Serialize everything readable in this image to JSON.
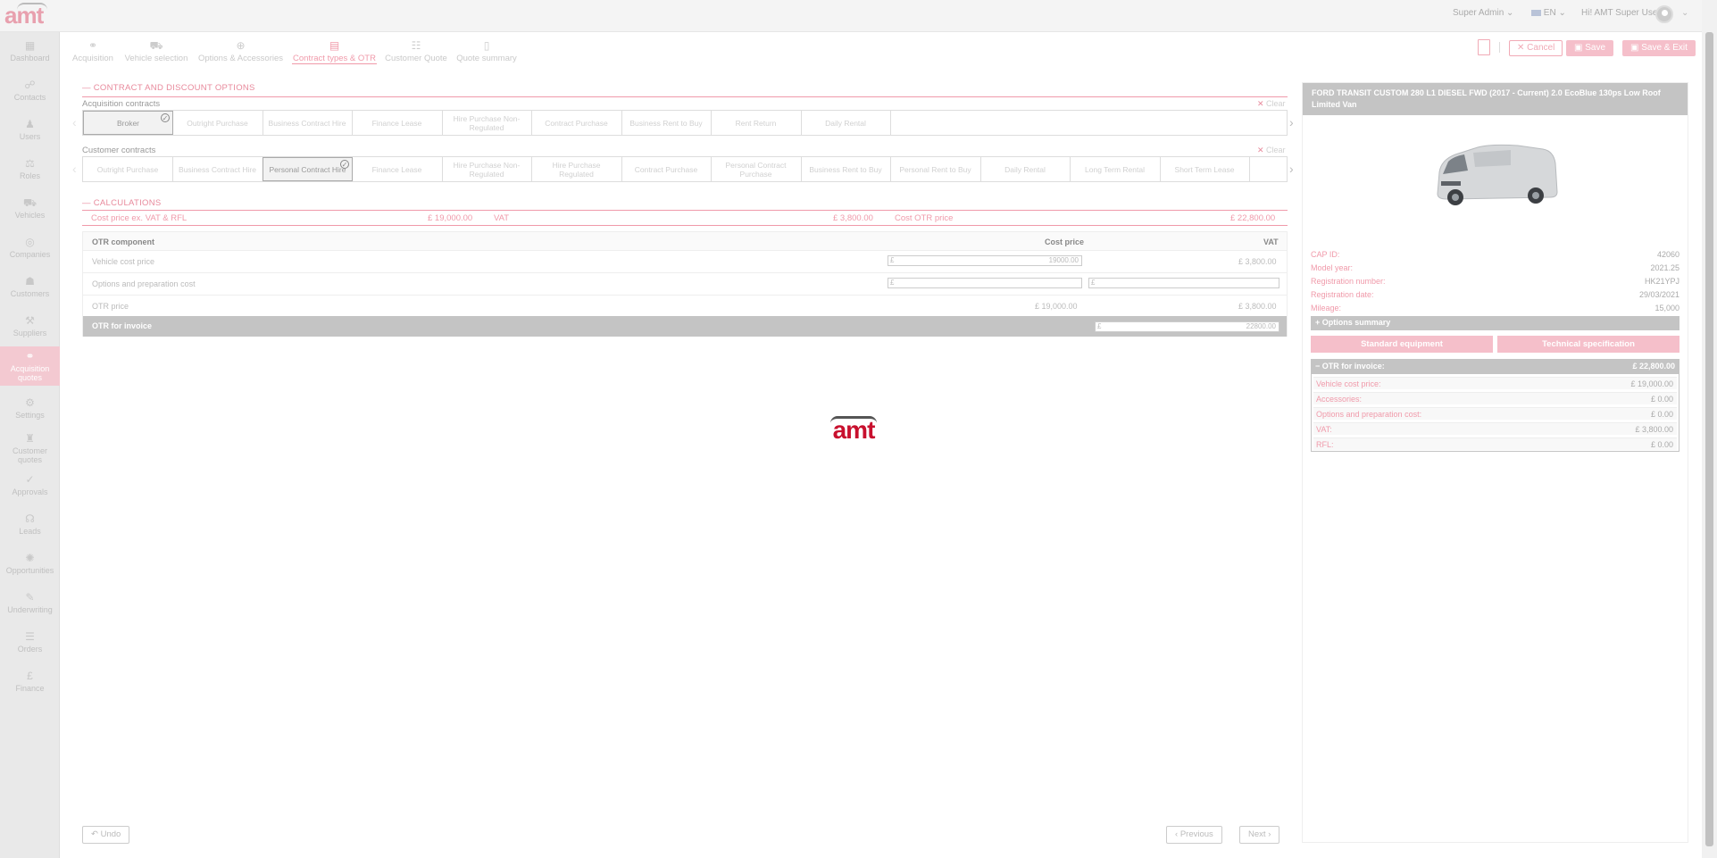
{
  "app": {
    "logo": "amt"
  },
  "topbar": {
    "role": "Super Admin",
    "language": "EN",
    "greeting": "Hi! AMT Super User"
  },
  "sidebar": {
    "items": [
      {
        "label": "Dashboard",
        "icon": "dashboard-icon"
      },
      {
        "label": "Contacts",
        "icon": "contacts-icon"
      },
      {
        "label": "Users",
        "icon": "user-icon"
      },
      {
        "label": "Roles",
        "icon": "roles-icon"
      },
      {
        "label": "Vehicles",
        "icon": "car-icon"
      },
      {
        "label": "Companies",
        "icon": "globe-icon"
      },
      {
        "label": "Customers",
        "icon": "customers-icon"
      },
      {
        "label": "Suppliers",
        "icon": "suppliers-icon"
      },
      {
        "label": "Acquisition quotes",
        "icon": "acquisition-icon"
      },
      {
        "label": "Settings",
        "icon": "gear-icon"
      },
      {
        "label": "Customer quotes",
        "icon": "customer-quotes-icon"
      },
      {
        "label": "Approvals",
        "icon": "check-icon"
      },
      {
        "label": "Leads",
        "icon": "leads-icon"
      },
      {
        "label": "Opportunities",
        "icon": "opportunities-icon"
      },
      {
        "label": "Underwriting",
        "icon": "underwriting-icon"
      },
      {
        "label": "Orders",
        "icon": "orders-icon"
      },
      {
        "label": "Finance",
        "icon": "pound-icon"
      }
    ]
  },
  "steps": [
    {
      "label": "Acquisition",
      "icon": "acquisition-icon"
    },
    {
      "label": "Vehicle selection",
      "icon": "car-icon"
    },
    {
      "label": "Options & Accessories",
      "icon": "plus-circle-icon"
    },
    {
      "label": "Contract types & OTR",
      "icon": "calculator-icon",
      "active": true
    },
    {
      "label": "Customer Quote",
      "icon": "quote-icon"
    },
    {
      "label": "Quote summary",
      "icon": "document-icon"
    }
  ],
  "actions": {
    "cancel": "Cancel",
    "save": "Save",
    "save_exit": "Save & Exit"
  },
  "contract_section": {
    "title": "CONTRACT AND DISCOUNT OPTIONS",
    "acquisition_label": "Acquisition contracts",
    "customer_label": "Customer contracts",
    "clear": "Clear",
    "acquisition_contracts": [
      "Broker",
      "Outright Purchase",
      "Business Contract Hire",
      "Finance Lease",
      "Hire Purchase Non-Regulated",
      "Contract Purchase",
      "Business Rent to Buy",
      "Rent Return",
      "Daily Rental"
    ],
    "acquisition_selected": "Broker",
    "customer_contracts": [
      "Outright Purchase",
      "Business Contract Hire",
      "Personal Contract Hire",
      "Finance Lease",
      "Hire Purchase Non-Regulated",
      "Hire Purchase Regulated",
      "Contract Purchase",
      "Personal Contract Purchase",
      "Business Rent to Buy",
      "Personal Rent to Buy",
      "Daily Rental",
      "Long Term Rental",
      "Short Term Lease",
      ""
    ],
    "customer_selected": "Personal Contract Hire"
  },
  "calculations": {
    "title": "CALCULATIONS",
    "cost_label": "Cost price ex. VAT & RFL",
    "cost_value": "£ 19,000.00",
    "vat_label": "VAT",
    "vat_value": "£ 3,800.00",
    "otr_label": "Cost OTR price",
    "otr_value": "£ 22,800.00"
  },
  "otr_table": {
    "headers": {
      "component": "OTR component",
      "cost": "Cost price",
      "vat": "VAT"
    },
    "rows": [
      {
        "label": "Vehicle cost price",
        "cost_input": "19000.00",
        "vat": "£ 3,800.00"
      },
      {
        "label": "Options and preparation cost",
        "cost_input": "",
        "vat_input": ""
      },
      {
        "label": "OTR price",
        "cost": "£ 19,000.00",
        "vat": "£ 3,800.00"
      }
    ],
    "invoice_label": "OTR for invoice",
    "invoice_input": "22800.00",
    "currency": "£"
  },
  "nav": {
    "undo": "Undo",
    "previous": "Previous",
    "next": "Next"
  },
  "vehicle": {
    "title": "FORD TRANSIT CUSTOM 280 L1 DIESEL FWD (2017 - Current) 2.0 EcoBlue 130ps Low Roof Limited Van",
    "details": [
      {
        "k": "CAP ID:",
        "v": "42060"
      },
      {
        "k": "Model year:",
        "v": "2021.25"
      },
      {
        "k": "Registration number:",
        "v": "HK21YPJ"
      },
      {
        "k": "Registration date:",
        "v": "29/03/2021"
      },
      {
        "k": "Mileage:",
        "v": "15,000"
      }
    ],
    "options_summary": "Options summary",
    "standard_equipment": "Standard equipment",
    "technical_specification": "Technical specification",
    "otr_invoice_label": "OTR for invoice:",
    "otr_invoice_value": "£ 22,800.00",
    "breakdown": [
      {
        "k": "Vehicle cost price:",
        "v": "£ 19,000.00"
      },
      {
        "k": "Accessories:",
        "v": "£ 0.00"
      },
      {
        "k": "Options and preparation cost:",
        "v": "£ 0.00"
      },
      {
        "k": "VAT:",
        "v": "£ 3,800.00"
      },
      {
        "k": "RFL:",
        "v": "£ 0.00"
      }
    ]
  },
  "colors": {
    "accent": "#f09aaa",
    "brand": "#c8102e",
    "sidebar_active": "#f3c9d1"
  }
}
